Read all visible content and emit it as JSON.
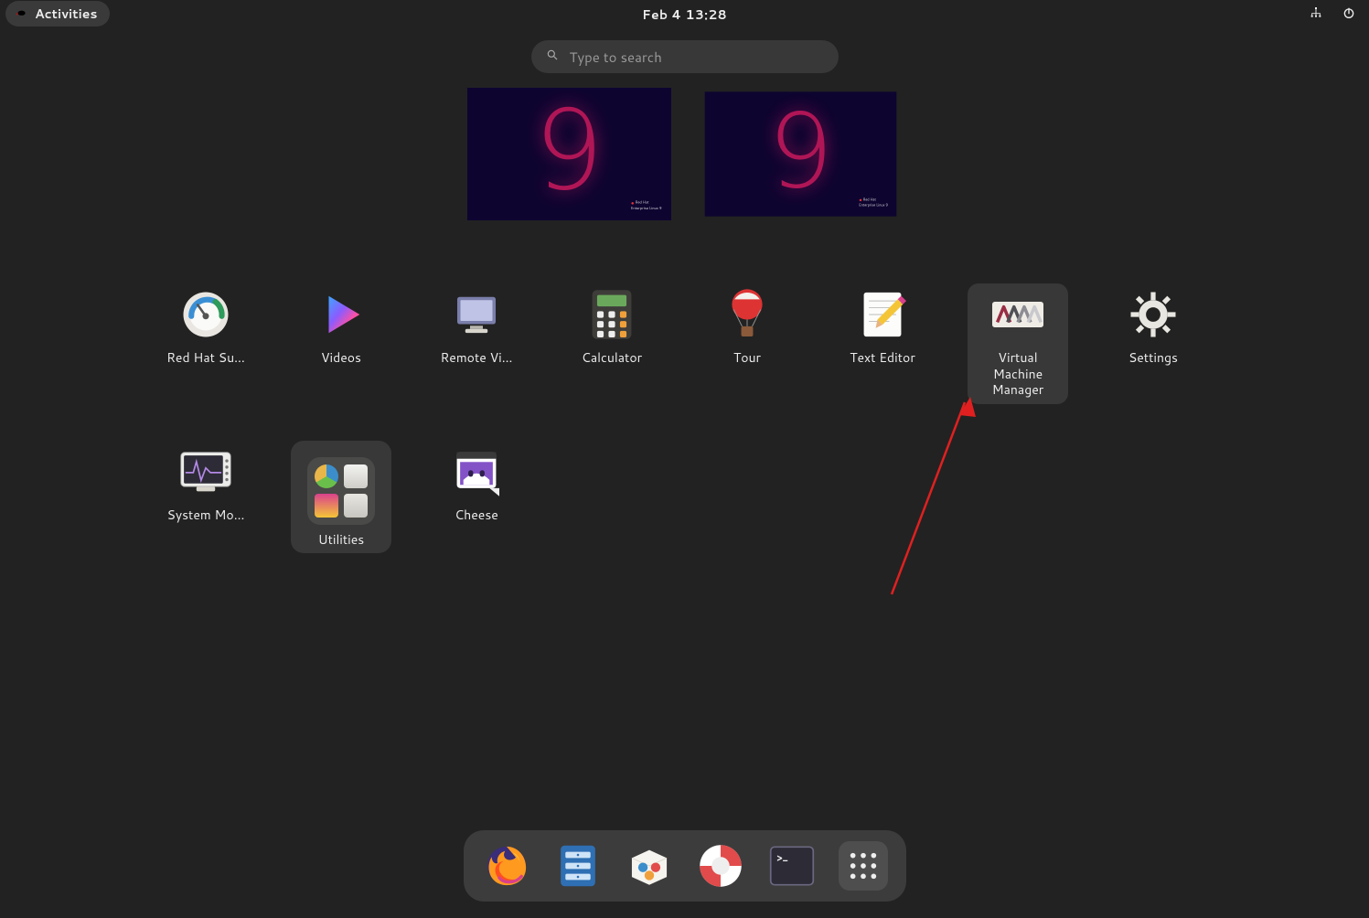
{
  "topbar": {
    "activities_label": "Activities",
    "clock": "Feb 4  13:28"
  },
  "search": {
    "placeholder": "Type to search"
  },
  "workspaces": {
    "count": 2
  },
  "apps": [
    {
      "id": "redhat-sub",
      "label": "Red Hat Su…",
      "highlight": false,
      "single_line": true
    },
    {
      "id": "videos",
      "label": "Videos",
      "highlight": false,
      "single_line": true
    },
    {
      "id": "remote-viewer",
      "label": "Remote Vi…",
      "highlight": false,
      "single_line": true
    },
    {
      "id": "calculator",
      "label": "Calculator",
      "highlight": false,
      "single_line": true
    },
    {
      "id": "tour",
      "label": "Tour",
      "highlight": false,
      "single_line": true
    },
    {
      "id": "text-editor",
      "label": "Text Editor",
      "highlight": false,
      "single_line": true
    },
    {
      "id": "virt-manager",
      "label": "Virtual Machine Manager",
      "highlight": true,
      "single_line": false
    },
    {
      "id": "settings",
      "label": "Settings",
      "highlight": false,
      "single_line": true
    },
    {
      "id": "system-monitor",
      "label": "System Mo…",
      "highlight": false,
      "single_line": true
    },
    {
      "id": "utilities",
      "label": "Utilities",
      "highlight": false,
      "single_line": true,
      "is_folder": true
    },
    {
      "id": "cheese",
      "label": "Cheese",
      "highlight": false,
      "single_line": true
    }
  ],
  "dock": [
    {
      "id": "firefox",
      "name": "firefox-icon"
    },
    {
      "id": "files",
      "name": "files-icon"
    },
    {
      "id": "software",
      "name": "software-icon"
    },
    {
      "id": "help",
      "name": "help-icon"
    },
    {
      "id": "terminal",
      "name": "terminal-icon"
    },
    {
      "id": "show-apps",
      "name": "show-apps-icon",
      "active": true
    }
  ]
}
